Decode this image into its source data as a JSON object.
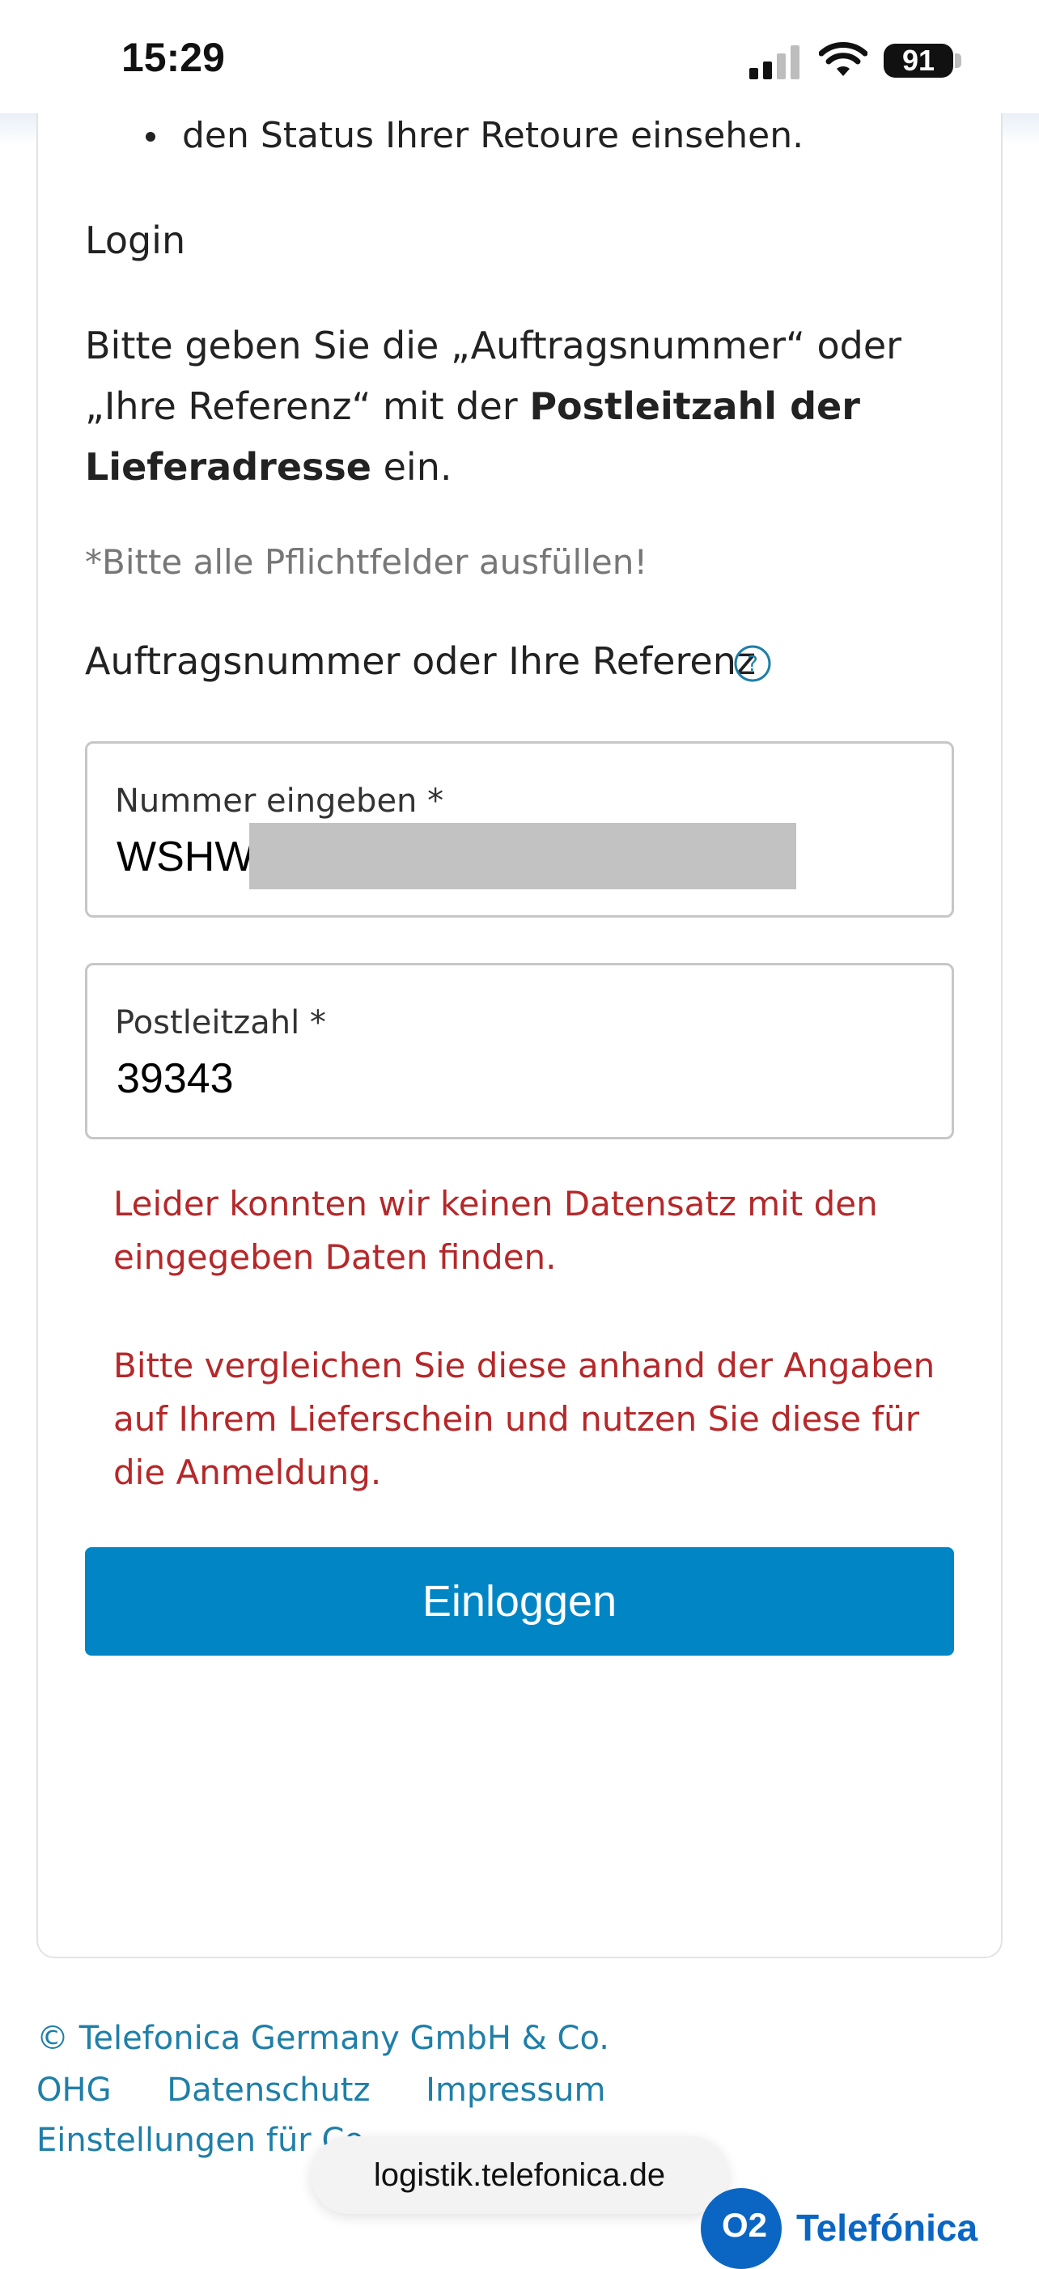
{
  "status_bar": {
    "time": "15:29",
    "battery": "91"
  },
  "content": {
    "bullet": "den Status Ihrer Retoure einsehen.",
    "heading": "Login",
    "intro_part1": "Bitte geben Sie die „Auftragsnummer“ oder „Ihre Referenz“ mit der ",
    "intro_bold": "Postleitzahl der Lieferadresse",
    "intro_part2": " ein.",
    "required_note": "*Bitte alle Pflichtfelder ausfüllen!",
    "field_label": "Auftragsnummer oder Ihre Referenz"
  },
  "form": {
    "order_field": {
      "label": "Nummer eingeben *",
      "value": "WSHW"
    },
    "zip_field": {
      "label": "Postleitzahl *",
      "value": "39343"
    },
    "error_1": "Leider konnten wir keinen Datensatz mit den eingegeben Daten finden.",
    "error_2": "Bitte vergleichen Sie diese anhand der Angaben auf Ihrem Lieferschein und nutzen Sie diese für die Anmeldung.",
    "login_button": "Einloggen"
  },
  "footer": {
    "copyright_a": "© Telefonica Germany GmbH & Co.",
    "copyright_b": "OHG",
    "datenschutz": "Datenschutz",
    "impressum": "Impressum",
    "cookies": "Einstellungen für Co",
    "url": "logistik.telefonica.de",
    "logo_mark": "O2",
    "logo_text": "Telefónica"
  },
  "colors": {
    "accent": "#0185c5",
    "error": "#b5282a",
    "link": "#1f7fa8"
  }
}
